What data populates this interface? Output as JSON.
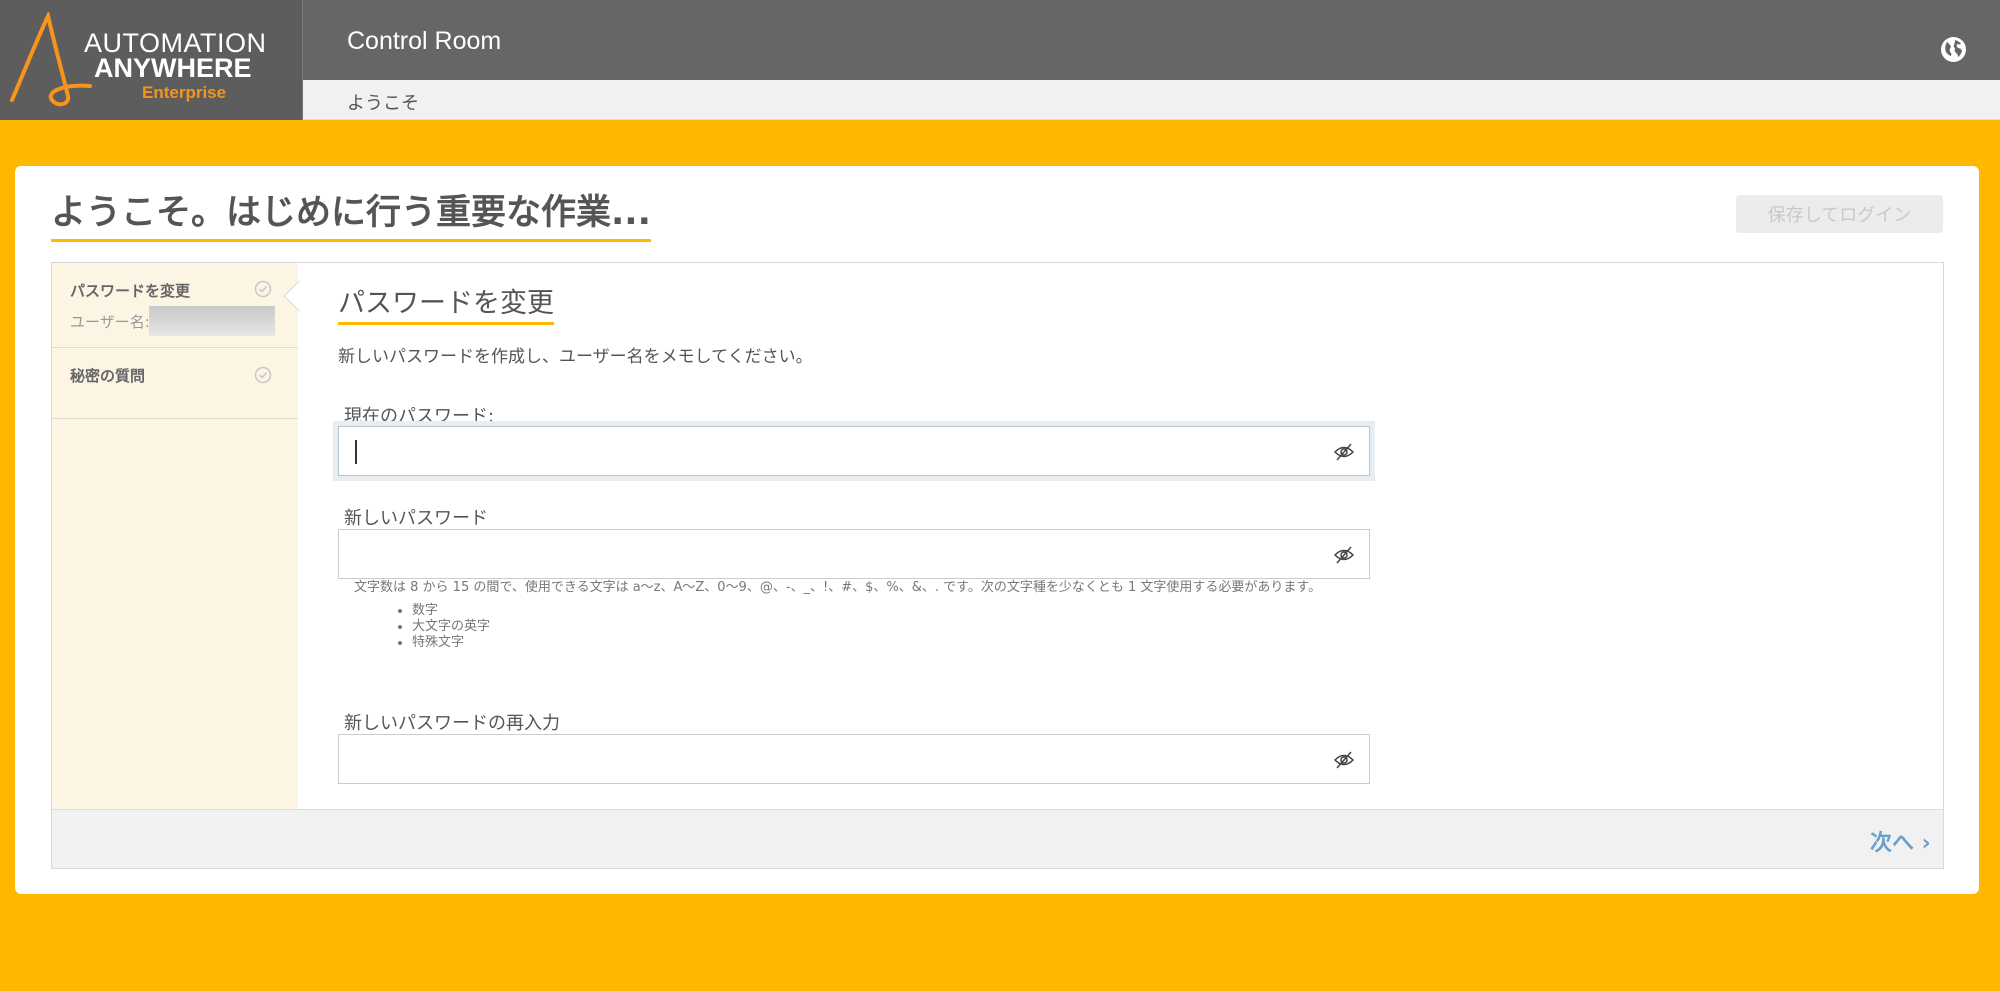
{
  "brand": {
    "line1": "AUTOMATION",
    "line2": "ANYWHERE",
    "line3": "Enterprise",
    "accent_color": "#F7941D"
  },
  "header": {
    "app_title": "Control Room",
    "globe_icon": "globe-icon",
    "breadcrumb": "ようこそ"
  },
  "page": {
    "title": "ようこそ。はじめに行う重要な作業...",
    "save_login_label": "保存してログイン",
    "background_color": "#FFB800"
  },
  "sidebar": {
    "items": [
      {
        "label": "パスワードを変更",
        "username_label": "ユーザー名:",
        "icon": "check-circle-icon",
        "active": true
      },
      {
        "label": "秘密の質問",
        "icon": "check-circle-icon",
        "active": false
      }
    ]
  },
  "section": {
    "title": "パスワードを変更",
    "description": "新しいパスワードを作成し、ユーザー名をメモしてください。",
    "fields": {
      "current": {
        "label": "現在のパスワード:",
        "value": "",
        "icon": "eye-slash-icon"
      },
      "new": {
        "label": "新しいパスワード",
        "value": "",
        "icon": "eye-slash-icon"
      },
      "confirm": {
        "label": "新しいパスワードの再入力",
        "value": "",
        "icon": "eye-slash-icon"
      }
    },
    "rules": {
      "text": "文字数は 8 から 15 の間で、使用できる文字は a〜z、A〜Z、0〜9、@、-、_、!、#、$、%、&、. です。次の文字種を少なくとも 1 文字使用する必要があります。",
      "items": [
        "数字",
        "大文字の英字",
        "特殊文字"
      ]
    }
  },
  "footer": {
    "next_label": "次へ ›",
    "next_color": "#6A9FCB"
  }
}
